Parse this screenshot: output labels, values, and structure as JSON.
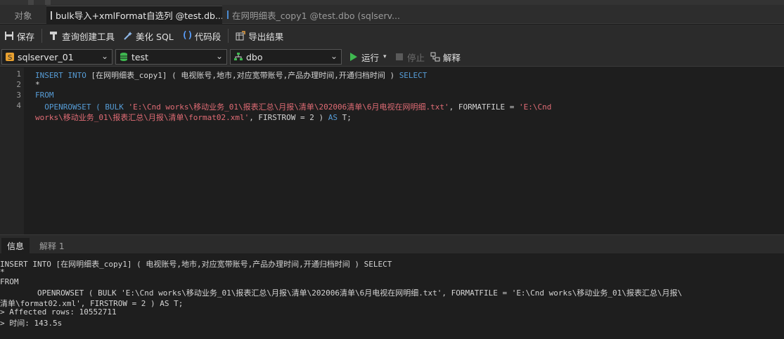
{
  "tabs": [
    {
      "label": "对象"
    },
    {
      "label": "bulk导入+xmlFormat自选列 @test.db..."
    },
    {
      "label": "在网明细表_copy1 @test.dbo (sqlserv..."
    }
  ],
  "toolbar": {
    "save": "保存",
    "query_builder": "查询创建工具",
    "beautify": "美化 SQL",
    "snippet": "代码段",
    "export": "导出结果"
  },
  "connection": {
    "server": "sqlserver_01",
    "database": "test",
    "schema": "dbo",
    "run": "运行",
    "stop": "停止",
    "explain": "解释"
  },
  "editor": {
    "line_numbers": [
      "1",
      "2",
      "3",
      "4"
    ],
    "l1_kw1": "INSERT INTO",
    "l1_tx": " [在网明细表_copy1] ( 电视账号,地市,对应宽带账号,产品办理时间,开通归档时间 ) ",
    "l1_kw2": "SELECT",
    "l2": "*",
    "l3": "FROM",
    "l4_kw1": "  OPENROWSET ( BULK ",
    "l4_st1": "'E:\\Cnd works\\移动业务_01\\报表汇总\\月报\\清单\\202006清单\\6月电视在网明细.txt'",
    "l4_tx1": ", FORMATFILE = ",
    "l4_st2": "'E:\\Cnd",
    "l5_st": "works\\移动业务_01\\报表汇总\\月报\\清单\\format02.xml'",
    "l5_tx": ", FIRSTROW = 2 ) ",
    "l5_kw": "AS",
    "l5_tx2": " T;"
  },
  "results": {
    "tabs": [
      "信息",
      "解释 1"
    ],
    "lines": [
      "INSERT INTO [在网明细表_copy1] ( 电视账号,地市,对应宽带账号,产品办理时间,开通归档时间 ) SELECT",
      "*",
      "FROM",
      "        OPENROWSET ( BULK 'E:\\Cnd works\\移动业务_01\\报表汇总\\月报\\清单\\202006清单\\6月电视在网明细.txt', FORMATFILE = 'E:\\Cnd works\\移动业务_01\\报表汇总\\月报\\",
      "清单\\format02.xml', FIRSTROW = 2 ) AS T;",
      "> Affected rows: 10552711",
      "> 时间: 143.5s"
    ]
  },
  "icons": {
    "save": "save-icon",
    "query_builder": "hammer-icon",
    "beautify": "magic-wand-icon",
    "snippet": "braces-icon",
    "export": "export-icon",
    "server": "server-connection-icon",
    "database": "database-icon",
    "schema": "schema-icon",
    "run": "play-icon",
    "stop": "stop-icon",
    "explain": "explain-icon"
  },
  "colors": {
    "keyword": "#569cd6",
    "string": "#e06c75",
    "run_green": "#3fb950"
  }
}
